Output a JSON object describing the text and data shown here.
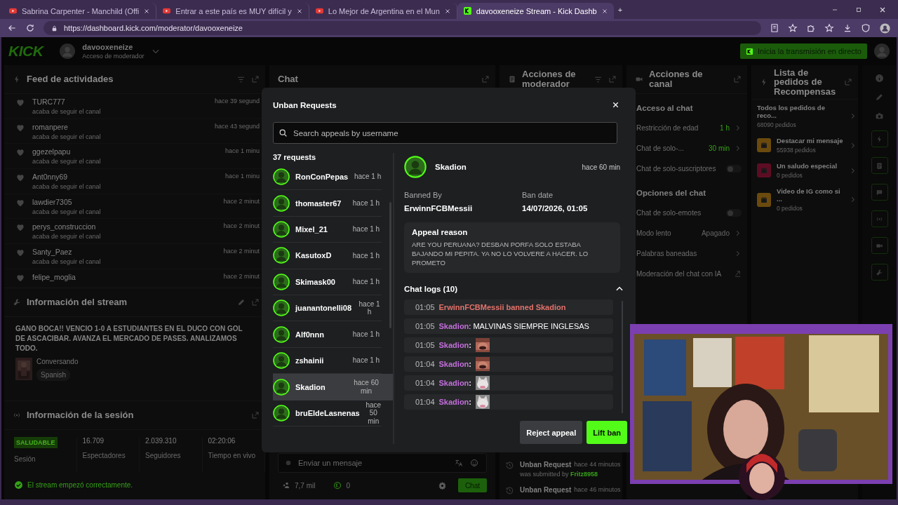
{
  "browser": {
    "tabs": [
      {
        "title": "Sabrina Carpenter - Manchild (Offi",
        "kind": "video",
        "selected": false
      },
      {
        "title": "Entrar a este país es MUY difícil y",
        "kind": "video",
        "selected": false
      },
      {
        "title": "Lo Mejor de Argentina en el Mun",
        "kind": "video",
        "selected": false
      },
      {
        "title": "davooxeneize Stream - Kick Dashb",
        "kind": "kick",
        "selected": true
      }
    ],
    "new_tab": "+",
    "url": "https://dashboard.kick.com/moderator/davooxeneize"
  },
  "header": {
    "logo": "KICK",
    "channel": "davooxeneize",
    "role": "Acceso de moderador",
    "go_live": "Inicia la transmisión en directo"
  },
  "activity_feed": {
    "title": "Feed de actividades",
    "items": [
      {
        "user": "TURC777",
        "action": "acaba de seguir el canal",
        "time": "hace 39 segund"
      },
      {
        "user": "romanpere",
        "action": "acaba de seguir el canal",
        "time": "hace 43 segund"
      },
      {
        "user": "ggezelpapu",
        "action": "acaba de seguir el canal",
        "time": "hace 1 minu"
      },
      {
        "user": "Ant0nny69",
        "action": "acaba de seguir el canal",
        "time": "hace 1 minu"
      },
      {
        "user": "lawdier7305",
        "action": "acaba de seguir el canal",
        "time": "hace 2 minut"
      },
      {
        "user": "perys_construccion",
        "action": "acaba de seguir el canal",
        "time": "hace 2 minut"
      },
      {
        "user": "Santy_Paez",
        "action": "acaba de seguir el canal",
        "time": "hace 2 minut"
      },
      {
        "user": "felipe_moglia",
        "time": "hace 2 minut"
      }
    ]
  },
  "stream_info": {
    "title": "Información del stream",
    "description": "GANO BOCA!! VENCIO 1-0 A ESTUDIANTES EN EL DUCO CON GOL DE ASCACIBAR. AVANZA EL MERCADO DE PASES. ANALIZAMOS TODO.",
    "category": "Conversando",
    "tag": "Spanish"
  },
  "session_info": {
    "title": "Información de la sesión",
    "status": "SALUDABLE",
    "status_label": "Sesión",
    "stats": [
      {
        "value": "16.709",
        "label": "Espectadores"
      },
      {
        "value": "2.039.310",
        "label": "Seguidores"
      },
      {
        "value": "02:20:06",
        "label": "Tiempo en vivo"
      }
    ],
    "message": "El stream empezó correctamente."
  },
  "chat": {
    "title": "Chat",
    "placeholder": "Enviar un mensaje",
    "viewers": "7,7 mil",
    "points": "0",
    "send": "Chat"
  },
  "moderator_actions": {
    "title": "Acciones de moderador",
    "items": [
      {
        "title": "Unban Request",
        "time": "hace 44 minutos",
        "text": "was submitted by",
        "user": "Fritz8958"
      },
      {
        "title": "Unban Request",
        "time": "hace 46 minutos"
      }
    ]
  },
  "channel_actions": {
    "title": "Acciones de canal",
    "sections": [
      {
        "title": "Acceso al chat",
        "items": [
          {
            "label": "Restricción de edad",
            "kind": "select",
            "value": "1 h",
            "on": true
          },
          {
            "label": "Chat de solo-...",
            "kind": "select",
            "value": "30 min",
            "on": true
          },
          {
            "label": "Chat de solo-suscriptores",
            "kind": "toggle",
            "on": false
          }
        ]
      },
      {
        "title": "Opciones del chat",
        "items": [
          {
            "label": "Chat de solo-emotes",
            "kind": "toggle",
            "on": false
          },
          {
            "label": "Modo lento",
            "kind": "select",
            "value": "Apagado",
            "on": false
          },
          {
            "label": "Palabras baneadas",
            "kind": "link"
          },
          {
            "label": "Moderación del chat con IA",
            "kind": "external"
          }
        ]
      }
    ]
  },
  "rewards": {
    "title": "Lista de pedidos de Recompensas",
    "all": {
      "title": "Todos los pedidos de reco...",
      "count": "68090 pedidos"
    },
    "items": [
      {
        "title": "Destacar mi mensaje",
        "count": "55938 pedidos",
        "color": "#6b4a0e"
      },
      {
        "title": "Un saludo especial",
        "count": "0 pedidos",
        "color": "#5c0d24"
      },
      {
        "title": "Video de IG como si ...",
        "count": "0 pedidos",
        "color": "#6b4a0e"
      }
    ]
  },
  "modal": {
    "title": "Unban Requests",
    "search_placeholder": "Search appeals by username",
    "count": "37 requests",
    "requests": [
      {
        "user": "RonConPepas",
        "time": "hace 1 h",
        "selected": false
      },
      {
        "user": "thomaster67",
        "time": "hace 1 h",
        "selected": false
      },
      {
        "user": "Mixel_21",
        "time": "hace 1 h",
        "selected": false
      },
      {
        "user": "KasutoxD",
        "time": "hace 1 h",
        "selected": false
      },
      {
        "user": "Skimask00",
        "time": "hace 1 h",
        "selected": false
      },
      {
        "user": "juanantonelli08",
        "time": "hace 1 h",
        "selected": false
      },
      {
        "user": "Alf0nnn",
        "time": "hace 1 h",
        "selected": false
      },
      {
        "user": "zshainii",
        "time": "hace 1 h",
        "selected": false
      },
      {
        "user": "Skadion",
        "time": "hace 60 min",
        "selected": true
      },
      {
        "user": "bruEldeLasnenas",
        "time": "hace 50 min",
        "selected": false
      }
    ],
    "detail": {
      "user": "Skadion",
      "time": "hace 60 min",
      "banned_by_label": "Banned By",
      "banned_by": "ErwinnFCBMessii",
      "ban_date_label": "Ban date",
      "ban_date": "14/07/2026, 01:05",
      "reason_title": "Appeal reason",
      "reason": "ARE YOU PERUANA? DESBAN PORFA SOLO ESTABA BAJANDO MI PEPITA. YA NO LO VOLVERE A HACER. LO PROMETO",
      "logs_title": "Chat logs (10)",
      "expanded": true,
      "logs": [
        {
          "time": "01:05",
          "kind": "ban",
          "text": "ErwinnFCBMessii banned Skadion"
        },
        {
          "time": "01:05",
          "kind": "text",
          "user": "Skadion",
          "text": ": MALVINAS SIEMPRE INGLESAS"
        },
        {
          "time": "01:05",
          "kind": "emote",
          "user": "Skadion",
          "text": ":"
        },
        {
          "time": "01:04",
          "kind": "emote",
          "user": "Skadion",
          "text": ":"
        },
        {
          "time": "01:04",
          "kind": "emote",
          "user": "Skadion",
          "text": ":"
        },
        {
          "time": "01:04",
          "kind": "emote",
          "user": "Skadion",
          "text": ":"
        }
      ]
    },
    "buttons": [
      {
        "label": "Reject appeal",
        "kind": "secondary"
      },
      {
        "label": "Lift ban",
        "kind": "primary"
      }
    ]
  }
}
